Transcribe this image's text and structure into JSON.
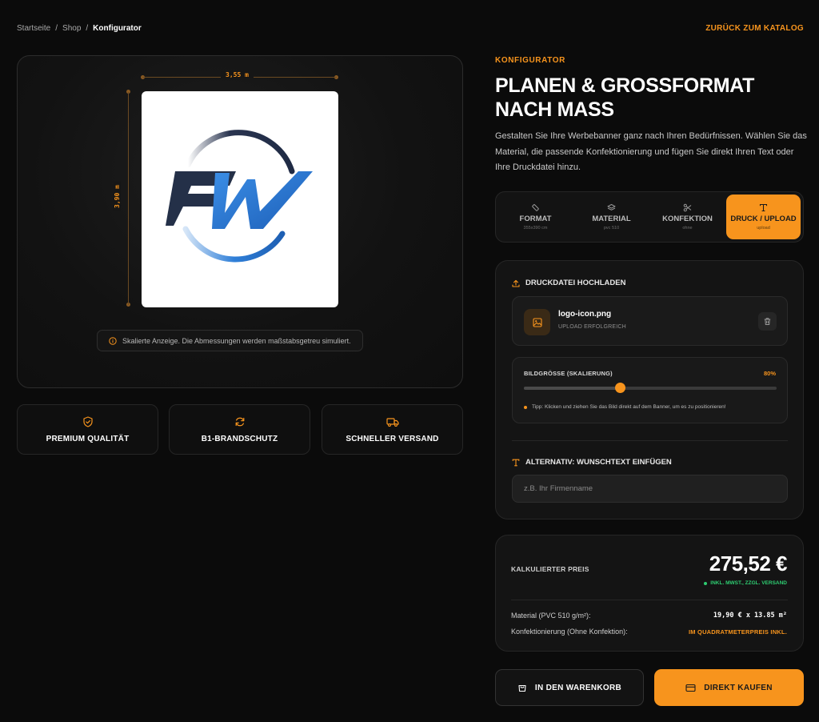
{
  "breadcrumb": {
    "items": [
      "Startseite",
      "Shop"
    ],
    "separator": "/",
    "current": "Konfigurator"
  },
  "back_link": "ZURÜCK ZUM KATALOG",
  "preview": {
    "width_label": "3,55 m",
    "height_label": "3,90 m",
    "note": "Skalierte Anzeige. Die Abmessungen werden maßstabsgetreu simuliert.",
    "note_icon": "info-icon",
    "logo_text": "FW"
  },
  "features": [
    {
      "label": "PREMIUM QUALITÄT",
      "icon": "shield-check-icon"
    },
    {
      "label": "B1-BRANDSCHUTZ",
      "icon": "refresh-icon"
    },
    {
      "label": "SCHNELLER VERSAND",
      "icon": "truck-icon"
    }
  ],
  "configurator": {
    "eyebrow": "KONFIGURATOR",
    "title": "PLANEN & GROSSFORMAT NACH MASS",
    "description": "Gestalten Sie Ihre Werbebanner ganz nach Ihren Bedürfnissen. Wählen Sie das Material, die passende Konfektionierung und fügen Sie direkt Ihren Text oder Ihre Druckdatei hinzu."
  },
  "tabs": [
    {
      "label": "FORMAT",
      "sub": "355x390 cm",
      "icon": "ruler-icon",
      "active": false
    },
    {
      "label": "MATERIAL",
      "sub": "pvc 510",
      "icon": "layers-icon",
      "active": false
    },
    {
      "label": "KONFEKTION",
      "sub": "ohne",
      "icon": "scissors-icon",
      "active": false
    },
    {
      "label": "DRUCK / UPLOAD",
      "sub": "upload",
      "icon": "type-icon",
      "active": true
    }
  ],
  "upload": {
    "heading": "DRUCKDATEI HOCHLADEN",
    "file_name": "logo-icon.png",
    "file_status": "UPLOAD ERFOLGREICH",
    "scale_label": "BILDGRÖSSE (SKALIERUNG)",
    "scale_value": "80%",
    "scale_fraction": 0.38,
    "tip": "Tipp: Klicken und ziehen Sie das Bild direkt auf dem Banner, um es zu positionieren!",
    "alt_heading": "ALTERNATIV: WUNSCHTEXT EINFÜGEN",
    "text_placeholder": "z.B. Ihr Firmenname",
    "text_value": ""
  },
  "price": {
    "label": "KALKULIERTER PREIS",
    "value": "275,52 €",
    "note": "INKL. MWST., ZZGL. VERSAND",
    "lines": [
      {
        "label": "Material (PVC 510 g/m²):",
        "value": "19,90 € x 13.85 m²"
      },
      {
        "label": "Konfektionierung (Ohne Konfektion):",
        "value": "IM QUADRATMETERPREIS INKL."
      }
    ]
  },
  "actions": {
    "cart": "IN DEN WARENKORB",
    "buy": "DIREKT KAUFEN"
  },
  "colors": {
    "accent": "#f7941d",
    "background": "#0b0b0b",
    "success": "#2ecc71",
    "logo_dark": "#1f2a44",
    "logo_blue": "#2f7fd8"
  }
}
